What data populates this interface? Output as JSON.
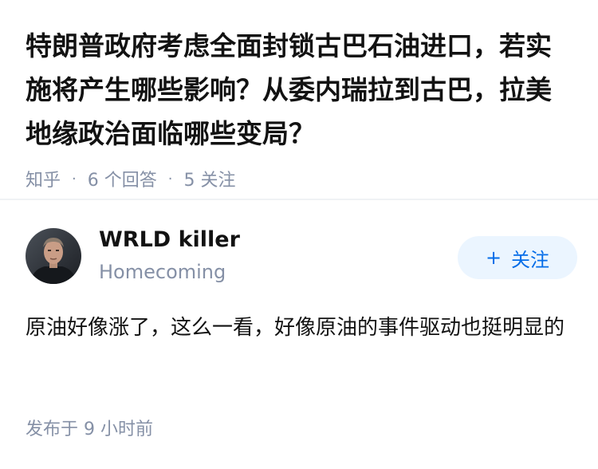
{
  "question": {
    "title": "特朗普政府考虑全面封锁古巴石油进口，若实施将产生哪些影响？从委内瑞拉到古巴，拉美地缘政治面临哪些变局？",
    "source": "知乎",
    "answers": "6 个回答",
    "followers": "5 关注"
  },
  "answer": {
    "author_name": "WRLD killer",
    "author_bio": "Homecoming",
    "follow_icon": "plus-icon",
    "follow_label": "关注",
    "content": "原油好像涨了，这么一看，好像原油的事件驱动也挺明显的",
    "time": "发布于 9 小时前"
  },
  "colors": {
    "accent": "#056de8",
    "follow_bg": "#ebf5ff",
    "meta_text": "#8590a6",
    "primary_text": "#121212"
  }
}
